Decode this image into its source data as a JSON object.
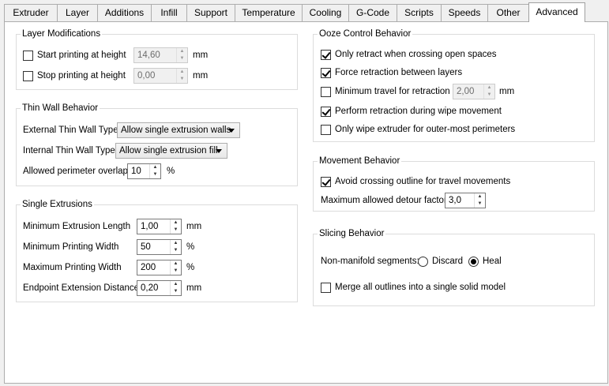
{
  "tabs": [
    {
      "label": "Extruder"
    },
    {
      "label": "Layer"
    },
    {
      "label": "Additions"
    },
    {
      "label": "Infill"
    },
    {
      "label": "Support"
    },
    {
      "label": "Temperature"
    },
    {
      "label": "Cooling"
    },
    {
      "label": "G-Code"
    },
    {
      "label": "Scripts"
    },
    {
      "label": "Speeds"
    },
    {
      "label": "Other"
    },
    {
      "label": "Advanced"
    }
  ],
  "active_tab": "Advanced",
  "layer_mods": {
    "title": "Layer Modifications",
    "start_label": "Start printing at height",
    "start_value": "14,60",
    "start_unit": "mm",
    "stop_label": "Stop printing at height",
    "stop_value": "0,00",
    "stop_unit": "mm"
  },
  "thin_wall": {
    "title": "Thin Wall Behavior",
    "external_label": "External Thin Wall Type",
    "external_value": "Allow single extrusion walls",
    "internal_label": "Internal Thin Wall Type",
    "internal_value": "Allow single extrusion fill",
    "overlap_label": "Allowed perimeter overlap",
    "overlap_value": "10",
    "overlap_unit": "%"
  },
  "single_ext": {
    "title": "Single Extrusions",
    "min_len_label": "Minimum Extrusion Length",
    "min_len_value": "1,00",
    "min_len_unit": "mm",
    "min_w_label": "Minimum Printing Width",
    "min_w_value": "50",
    "min_w_unit": "%",
    "max_w_label": "Maximum Printing Width",
    "max_w_value": "200",
    "max_w_unit": "%",
    "endpoint_label": "Endpoint Extension Distance",
    "endpoint_value": "0,20",
    "endpoint_unit": "mm"
  },
  "ooze": {
    "title": "Ooze Control Behavior",
    "only_retract": "Only retract when crossing open spaces",
    "force_retract": "Force retraction between layers",
    "min_travel": "Minimum travel for retraction",
    "min_travel_value": "2,00",
    "min_travel_unit": "mm",
    "wipe_retract": "Perform retraction during wipe movement",
    "only_wipe": "Only wipe extruder for outer-most perimeters"
  },
  "movement": {
    "title": "Movement Behavior",
    "avoid": "Avoid crossing outline for travel movements",
    "detour_label": "Maximum allowed detour factor",
    "detour_value": "3,0"
  },
  "slicing": {
    "title": "Slicing Behavior",
    "nonmanifold_label": "Non-manifold segments:",
    "discard": "Discard",
    "heal": "Heal",
    "merge": "Merge all outlines into a single solid model"
  }
}
